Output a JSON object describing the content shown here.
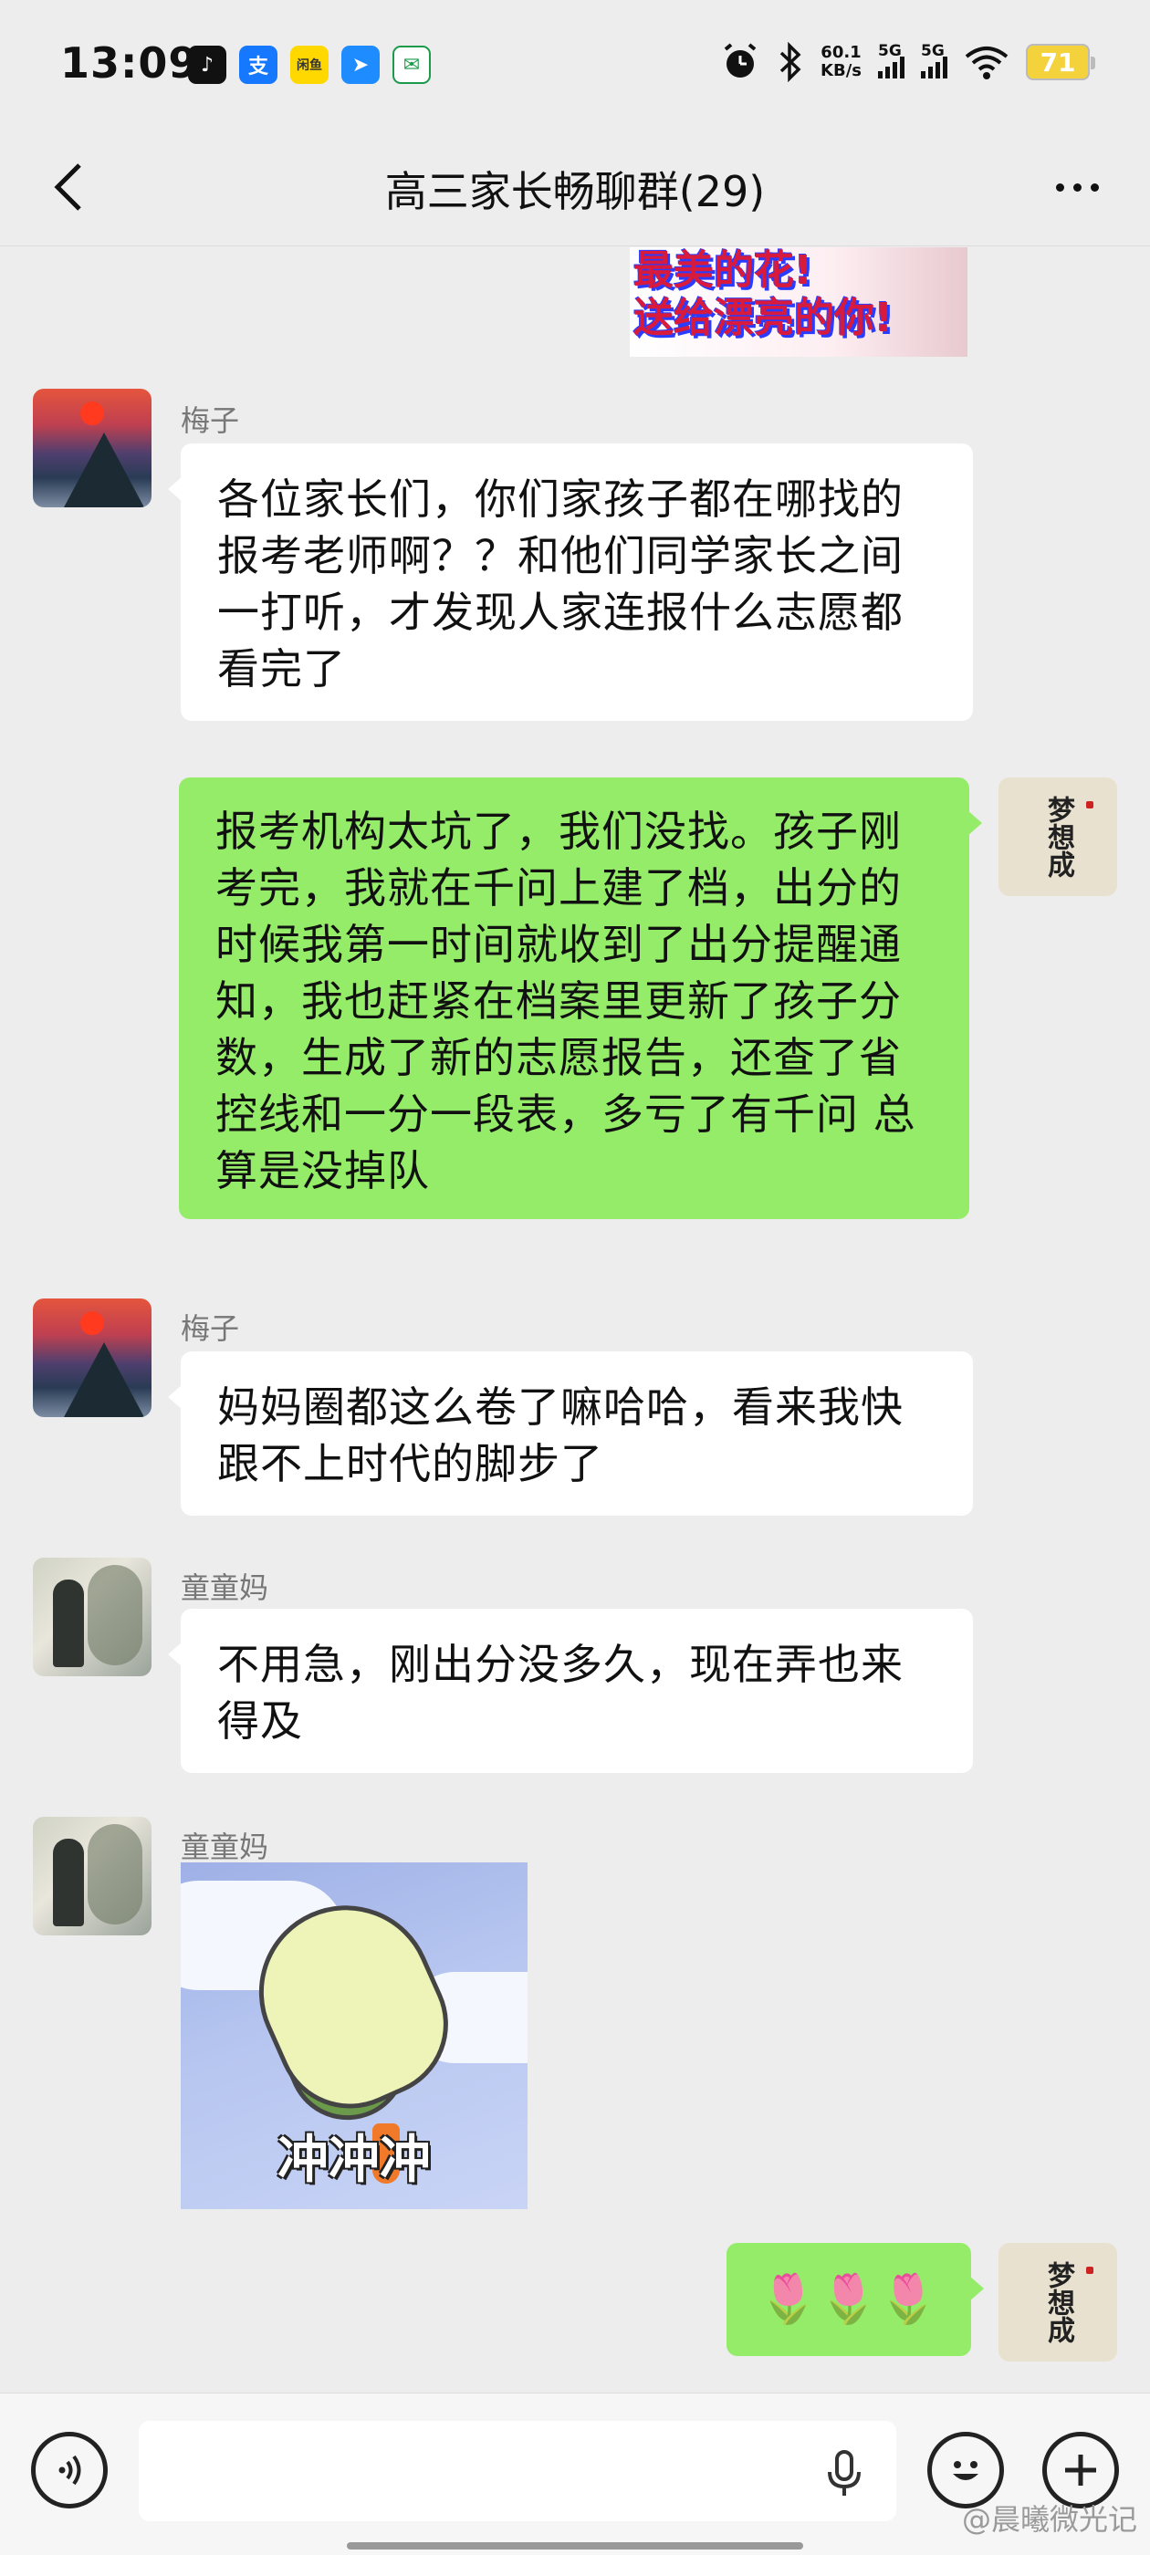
{
  "status_bar": {
    "time": "13:09",
    "app_icons": [
      {
        "name": "tiktok-icon",
        "glyph": "♪",
        "color": "#111111"
      },
      {
        "name": "alipay-icon",
        "glyph": "支",
        "color": "#1677ff"
      },
      {
        "name": "xianyu-icon",
        "glyph": "闲鱼",
        "color": "#ffd800"
      },
      {
        "name": "feishu-icon",
        "glyph": "➤",
        "color": "#1e8bff"
      },
      {
        "name": "post-icon",
        "glyph": "✉",
        "color": "#1a9a4a"
      }
    ],
    "net_speed_value": "60.1",
    "net_speed_unit": "KB/s",
    "signal1_label": "5G",
    "signal2_label": "5G",
    "battery": "71"
  },
  "header": {
    "title": "高三家长畅聊群(29)"
  },
  "top_image_text": [
    "最美的花!",
    "送给漂亮的你!"
  ],
  "messages": [
    {
      "sender": "梅子",
      "text": "各位家长们，你们家孩子都在哪找的报考老师啊？？和他们同学家长之间一打听，才发现人家连报什么志愿都看完了"
    },
    {
      "sender": "",
      "text": "报考机构太坑了，我们没找。孩子刚考完，我就在千问上建了档，出分的时候我第一时间就收到了出分提醒通知，我也赶紧在档案里更新了孩子分数，生成了新的志愿报告，还查了省控线和一分一段表，多亏了有千问 总算是没掉队"
    },
    {
      "sender": "梅子",
      "text": "妈妈圈都这么卷了嘛哈哈，看来我快跟不上时代的脚步了"
    },
    {
      "sender": "童童妈",
      "text": "不用急，刚出分没多久，现在弄也来得及"
    },
    {
      "sender": "童童妈",
      "sticker_caption": "冲冲冲"
    },
    {
      "sender": "",
      "text": "🌷🌷🌷"
    }
  ],
  "my_avatar_text": "梦想成",
  "input": {
    "placeholder": ""
  },
  "watermark": "@晨曦微光记",
  "colors": {
    "out_bubble": "#95ec69",
    "in_bubble": "#ffffff",
    "background": "#ededed"
  }
}
